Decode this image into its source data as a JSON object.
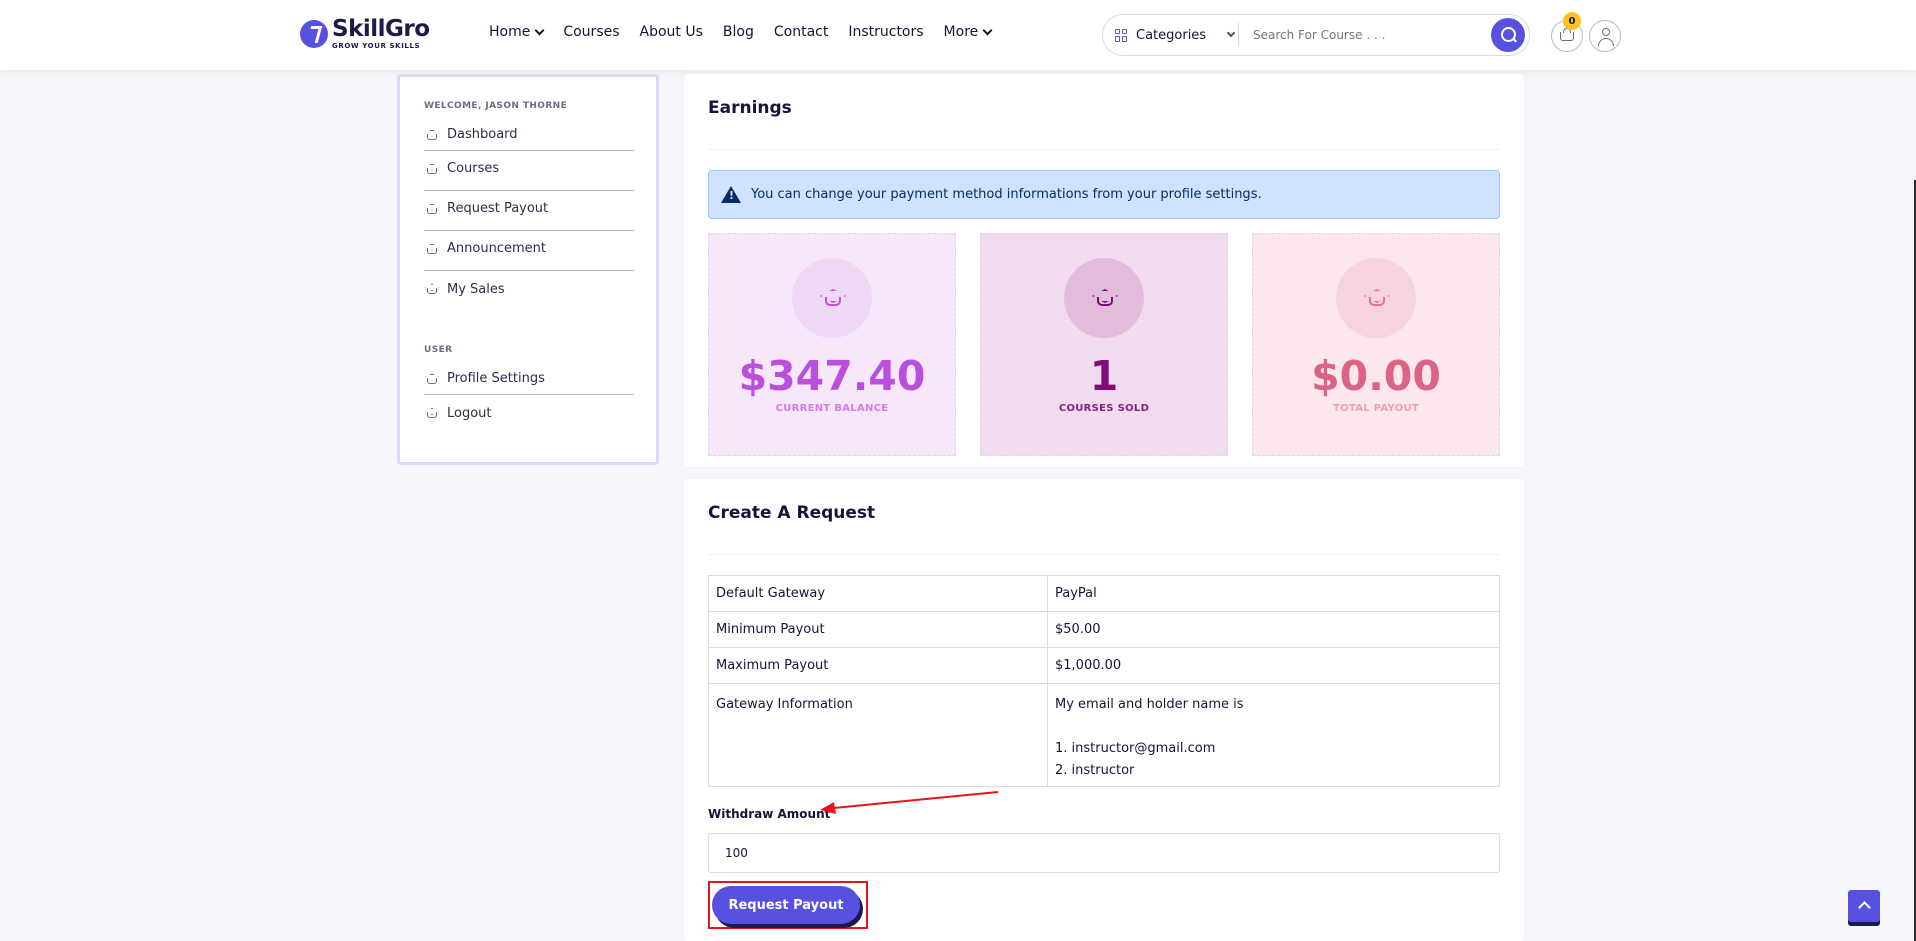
{
  "header": {
    "brand": "SkillGro",
    "tagline": "GROW YOUR SKILLS",
    "nav": [
      "Home",
      "Courses",
      "About Us",
      "Blog",
      "Contact",
      "Instructors",
      "More"
    ],
    "categories_label": "Categories",
    "search_placeholder": "Search For Course . . .",
    "cart_count": "0"
  },
  "sidebar": {
    "welcome": "WELCOME, JASON THORNE",
    "items": [
      "Dashboard",
      "Courses",
      "Request Payout",
      "Announcement",
      "My Sales"
    ],
    "user_heading": "USER",
    "user_items": [
      "Profile Settings",
      "Logout"
    ]
  },
  "earnings": {
    "title": "Earnings",
    "alert": "You can change your payment method informations from your profile settings.",
    "stats": [
      {
        "value": "$347.40",
        "label": "CURRENT BALANCE"
      },
      {
        "value": "1",
        "label": "COURSES SOLD"
      },
      {
        "value": "$0.00",
        "label": "TOTAL PAYOUT"
      }
    ]
  },
  "request": {
    "title": "Create A Request",
    "rows": [
      {
        "key": "Default Gateway",
        "value": "PayPal"
      },
      {
        "key": "Minimum Payout",
        "value": "$50.00"
      },
      {
        "key": "Maximum Payout",
        "value": "$1,000.00"
      }
    ],
    "gateway_info_key": "Gateway Information",
    "gateway_info_lines": [
      "My email and holder name is",
      "1. instructor@gmail.com",
      "2. instructor"
    ],
    "withdraw_label": "Withdraw Amount",
    "withdraw_value": "100",
    "button_label": "Request Payout"
  },
  "colors": {
    "primary": "#5751e1",
    "highlight": "#e8141c"
  }
}
